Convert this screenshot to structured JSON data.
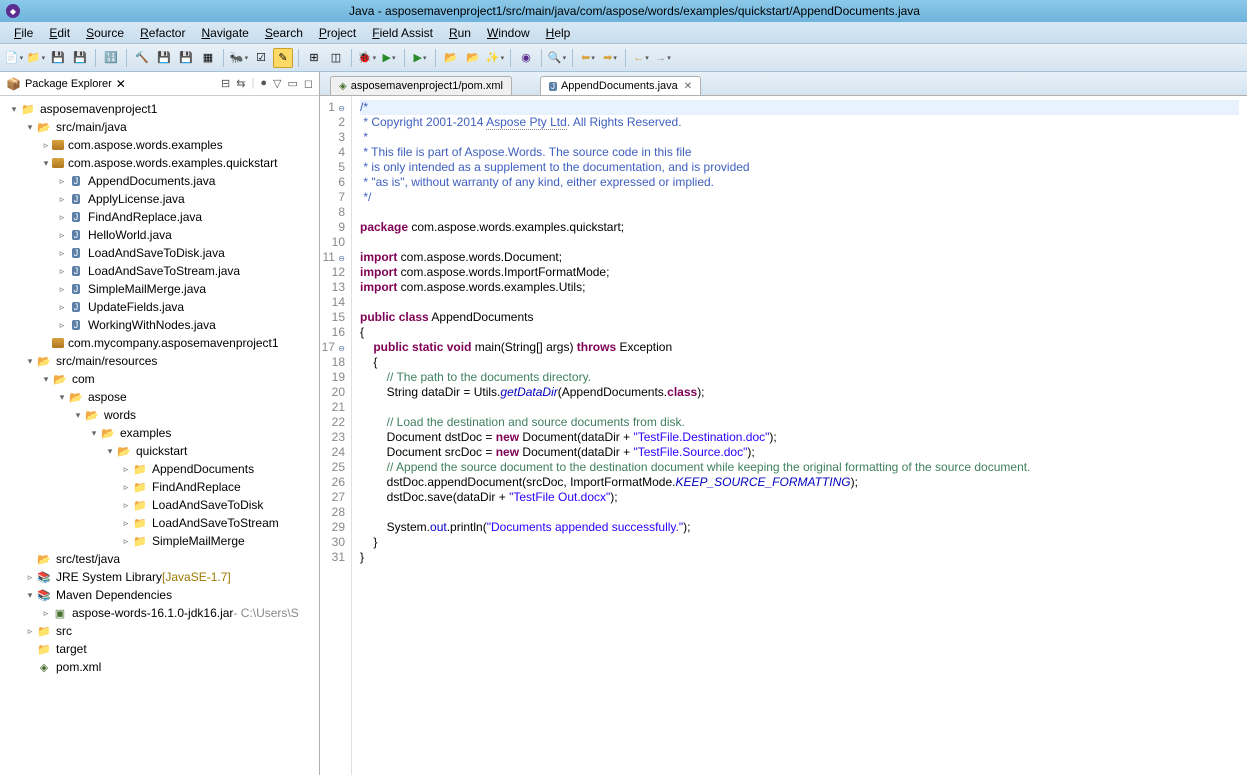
{
  "title": "Java - asposemavenproject1/src/main/java/com/aspose/words/examples/quickstart/AppendDocuments.java",
  "menus": [
    "File",
    "Edit",
    "Source",
    "Refactor",
    "Navigate",
    "Search",
    "Project",
    "Field Assist",
    "Run",
    "Window",
    "Help"
  ],
  "sidebar": {
    "view_title": "Package Explorer",
    "tree": [
      {
        "d": 0,
        "tw": "▾",
        "ic": "proj",
        "t": "asposemavenproject1"
      },
      {
        "d": 1,
        "tw": "▾",
        "ic": "folder-o",
        "t": "src/main/java"
      },
      {
        "d": 2,
        "tw": "▹",
        "ic": "pkg",
        "t": "com.aspose.words.examples"
      },
      {
        "d": 2,
        "tw": "▾",
        "ic": "pkg",
        "t": "com.aspose.words.examples.quickstart"
      },
      {
        "d": 3,
        "tw": "▹",
        "ic": "java",
        "t": "AppendDocuments.java"
      },
      {
        "d": 3,
        "tw": "▹",
        "ic": "java",
        "t": "ApplyLicense.java"
      },
      {
        "d": 3,
        "tw": "▹",
        "ic": "java",
        "t": "FindAndReplace.java"
      },
      {
        "d": 3,
        "tw": "▹",
        "ic": "java",
        "t": "HelloWorld.java"
      },
      {
        "d": 3,
        "tw": "▹",
        "ic": "java",
        "t": "LoadAndSaveToDisk.java"
      },
      {
        "d": 3,
        "tw": "▹",
        "ic": "java",
        "t": "LoadAndSaveToStream.java"
      },
      {
        "d": 3,
        "tw": "▹",
        "ic": "java",
        "t": "SimpleMailMerge.java"
      },
      {
        "d": 3,
        "tw": "▹",
        "ic": "java",
        "t": "UpdateFields.java"
      },
      {
        "d": 3,
        "tw": "▹",
        "ic": "java",
        "t": "WorkingWithNodes.java"
      },
      {
        "d": 2,
        "tw": "",
        "ic": "pkg",
        "t": "com.mycompany.asposemavenproject1"
      },
      {
        "d": 1,
        "tw": "▾",
        "ic": "folder-o",
        "t": "src/main/resources"
      },
      {
        "d": 2,
        "tw": "▾",
        "ic": "folder-o",
        "t": "com"
      },
      {
        "d": 3,
        "tw": "▾",
        "ic": "folder-o",
        "t": "aspose"
      },
      {
        "d": 4,
        "tw": "▾",
        "ic": "folder-o",
        "t": "words"
      },
      {
        "d": 5,
        "tw": "▾",
        "ic": "folder-o",
        "t": "examples"
      },
      {
        "d": 6,
        "tw": "▾",
        "ic": "folder-o",
        "t": "quickstart"
      },
      {
        "d": 7,
        "tw": "▹",
        "ic": "folder",
        "t": "AppendDocuments"
      },
      {
        "d": 7,
        "tw": "▹",
        "ic": "folder",
        "t": "FindAndReplace"
      },
      {
        "d": 7,
        "tw": "▹",
        "ic": "folder",
        "t": "LoadAndSaveToDisk"
      },
      {
        "d": 7,
        "tw": "▹",
        "ic": "folder",
        "t": "LoadAndSaveToStream"
      },
      {
        "d": 7,
        "tw": "▹",
        "ic": "folder",
        "t": "SimpleMailMerge"
      },
      {
        "d": 1,
        "tw": "",
        "ic": "folder-o",
        "t": "src/test/java"
      },
      {
        "d": 1,
        "tw": "▹",
        "ic": "lib",
        "t": "JRE System Library",
        "extra": " [JavaSE-1.7]"
      },
      {
        "d": 1,
        "tw": "▾",
        "ic": "lib",
        "t": "Maven Dependencies"
      },
      {
        "d": 2,
        "tw": "▹",
        "ic": "jar",
        "t": "aspose-words-16.1.0-jdk16.jar",
        "gray": " - C:\\Users\\S"
      },
      {
        "d": 1,
        "tw": "▹",
        "ic": "folder",
        "t": "src"
      },
      {
        "d": 1,
        "tw": "",
        "ic": "folder",
        "t": "target"
      },
      {
        "d": 1,
        "tw": "",
        "ic": "xml",
        "t": "pom.xml"
      }
    ]
  },
  "tabs": [
    {
      "icon": "M",
      "label": "asposemavenproject1/pom.xml",
      "active": false
    },
    {
      "icon": "J",
      "label": "AppendDocuments.java",
      "active": true
    }
  ],
  "code": {
    "lines": [
      {
        "n": 1,
        "html": "<span class='c-doc'>/*</span>"
      },
      {
        "n": 2,
        "html": "<span class='c-doc'> * Copyright 2001-2014 <span class='underline-dotted'>Aspose Pty Ltd</span>. All Rights Reserved.</span>"
      },
      {
        "n": 3,
        "html": "<span class='c-doc'> *</span>"
      },
      {
        "n": 4,
        "html": "<span class='c-doc'> * This file is part of Aspose.Words. The source code in this file</span>"
      },
      {
        "n": 5,
        "html": "<span class='c-doc'> * is only intended as a supplement to the documentation, and is provided</span>"
      },
      {
        "n": 6,
        "html": "<span class='c-doc'> * \"as is\", without warranty of any kind, either expressed or implied.</span>"
      },
      {
        "n": 7,
        "html": "<span class='c-doc'> */</span>"
      },
      {
        "n": 8,
        "html": ""
      },
      {
        "n": 9,
        "html": "<span class='c-kw'>package</span> com.aspose.words.examples.quickstart;"
      },
      {
        "n": 10,
        "html": ""
      },
      {
        "n": 11,
        "html": "<span class='c-kw'>import</span> com.aspose.words.Document;"
      },
      {
        "n": 12,
        "html": "<span class='c-kw'>import</span> com.aspose.words.ImportFormatMode;"
      },
      {
        "n": 13,
        "html": "<span class='c-kw'>import</span> com.aspose.words.examples.Utils;"
      },
      {
        "n": 14,
        "html": ""
      },
      {
        "n": 15,
        "html": "<span class='c-kw'>public</span> <span class='c-kw'>class</span> AppendDocuments"
      },
      {
        "n": 16,
        "html": "{"
      },
      {
        "n": 17,
        "html": "    <span class='c-kw'>public</span> <span class='c-kw'>static</span> <span class='c-kw'>void</span> main(String[] args) <span class='c-kw'>throws</span> Exception"
      },
      {
        "n": 18,
        "html": "    {"
      },
      {
        "n": 19,
        "html": "        <span class='c-comment'>// The path to the documents directory.</span>"
      },
      {
        "n": 20,
        "html": "        String dataDir = Utils.<span class='c-static'>getDataDir</span>(AppendDocuments.<span class='c-kw'>class</span>);"
      },
      {
        "n": 21,
        "html": ""
      },
      {
        "n": 22,
        "html": "        <span class='c-comment'>// Load the destination and source documents from disk.</span>"
      },
      {
        "n": 23,
        "html": "        Document dstDoc = <span class='c-kw'>new</span> Document(dataDir + <span class='c-str'>\"TestFile.Destination.doc\"</span>);"
      },
      {
        "n": 24,
        "html": "        Document srcDoc = <span class='c-kw'>new</span> Document(dataDir + <span class='c-str'>\"TestFile.Source.doc\"</span>);"
      },
      {
        "n": 25,
        "html": "        <span class='c-comment'>// Append the source document to the destination document while keeping the original formatting of the source document.</span>"
      },
      {
        "n": 26,
        "html": "        dstDoc.appendDocument(srcDoc, ImportFormatMode.<span class='c-static'>KEEP_SOURCE_FORMATTING</span>);"
      },
      {
        "n": 27,
        "html": "        dstDoc.save(dataDir + <span class='c-str'>\"TestFile Out.docx\"</span>);"
      },
      {
        "n": 28,
        "html": ""
      },
      {
        "n": 29,
        "html": "        System.<span class='c-field'>out</span>.println(<span class='c-str'>\"Documents appended successfully.\"</span>);"
      },
      {
        "n": 30,
        "html": "    }"
      },
      {
        "n": 31,
        "html": "}"
      }
    ]
  }
}
